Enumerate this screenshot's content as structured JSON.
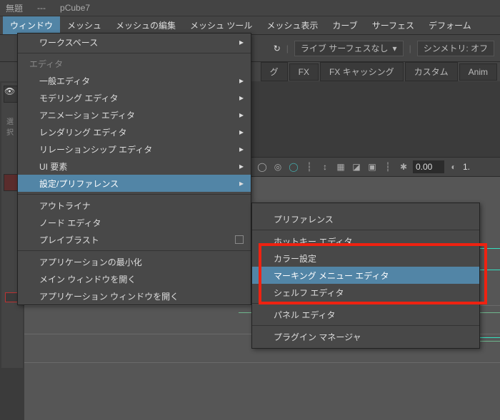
{
  "title": {
    "prefix": "無題",
    "dashes": "---",
    "scene": "pCube7"
  },
  "menubar": {
    "items": [
      "ウィンドウ",
      "メッシュ",
      "メッシュの編集",
      "メッシュ ツール",
      "メッシュ表示",
      "カーブ",
      "サーフェス",
      "デフォーム"
    ],
    "active_index": 0
  },
  "toolbar": {
    "live_label": "ライブ サーフェスなし",
    "symmetry_label": "シンメトリ: オフ"
  },
  "shelf": {
    "tabs": [
      "グ",
      "FX",
      "FX キャッシング",
      "カスタム",
      "Anim"
    ]
  },
  "viewport_toolbar": {
    "value": "0.00",
    "value2": "1."
  },
  "primary_menu": {
    "section1": "ワークスペース",
    "editor_label": "エディタ",
    "editors": [
      "一般エディタ",
      "モデリング エディタ",
      "アニメーション エディタ",
      "レンダリング エディタ",
      "リレーションシップ エディタ",
      "UI 要素",
      "設定/プリファレンス"
    ],
    "editors_hl_index": 6,
    "items2": [
      "アウトライナ",
      "ノード エディタ",
      "プレイブラスト"
    ],
    "items3": [
      "アプリケーションの最小化",
      "メイン ウィンドウを開く",
      "アプリケーション ウィンドウを開く"
    ]
  },
  "sub_menu": {
    "items": [
      "プリファレンス",
      "ホットキー エディタ",
      "カラー設定",
      "マーキング メニュー エディタ",
      "シェルフ エディタ",
      "パネル エディタ",
      "プラグイン マネージャ"
    ],
    "hl_index": 3
  },
  "icons": {
    "reload": "↻",
    "chevron": "▾",
    "triangle": "▸",
    "circle": "◯",
    "target": "◎",
    "grid": "▦",
    "axis": "↕",
    "camera": "◪",
    "fit": "⌂"
  }
}
